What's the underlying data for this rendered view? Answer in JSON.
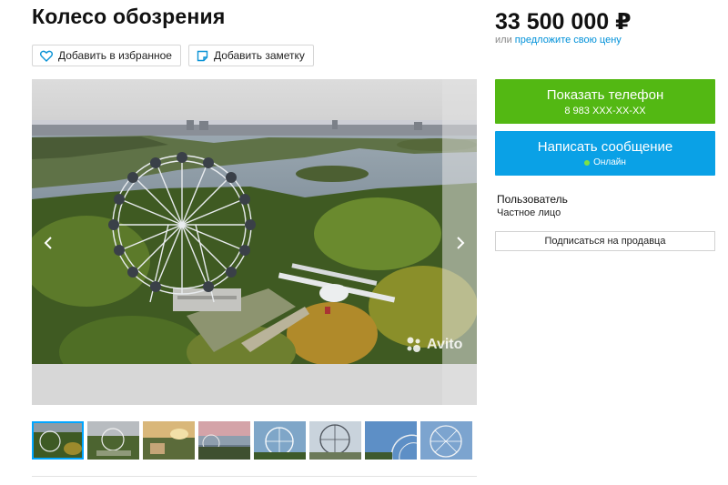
{
  "listing": {
    "title": "Колесо обозрения",
    "favorite_label": "Добавить в избранное",
    "note_label": "Добавить заметку",
    "watermark": "Avito"
  },
  "price": {
    "amount": "33 500 000 ₽",
    "or": "или",
    "offer_link": "предложите свою цену"
  },
  "contact": {
    "phone_label": "Показать телефон",
    "phone_masked": "8 983 XXX-XX-XX",
    "message_label": "Написать сообщение",
    "status": "Онлайн"
  },
  "seller": {
    "name": "Пользователь",
    "type": "Частное лицо",
    "subscribe_label": "Подписаться на продавца"
  },
  "gallery": {
    "thumbnail_count": 8,
    "active_thumbnail": 1
  },
  "colors": {
    "phone_button": "#53b813",
    "message_button": "#0aa1e6",
    "link": "#0091d9",
    "online_dot": "#7ee045",
    "active_thumb_border": "#00a6ff"
  }
}
